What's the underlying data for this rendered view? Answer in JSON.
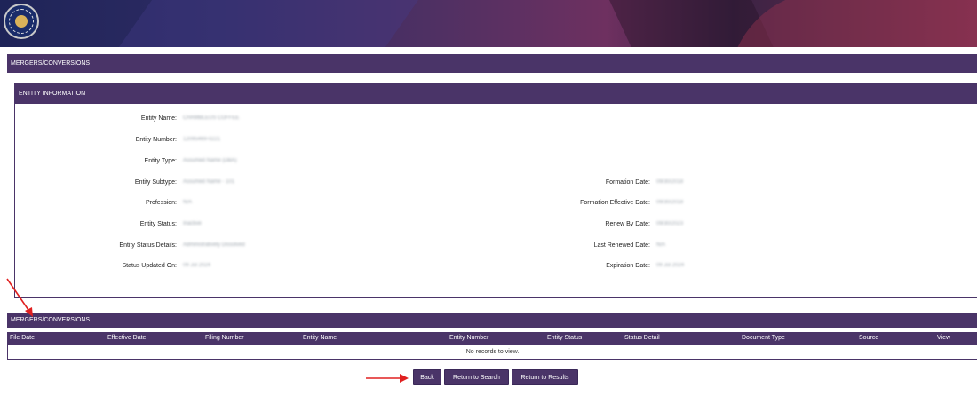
{
  "page": {
    "top_section_title": "MERGERS/CONVERSIONS",
    "entity_section_title": "ENTITY INFORMATION",
    "mergers_section_title": "MERGERS/CONVERSIONS"
  },
  "entity": {
    "left": [
      {
        "label": "Entity Name:",
        "value": "CHAMBLEUS COFFEE"
      },
      {
        "label": "Entity Number:",
        "value": "12095469-0221"
      },
      {
        "label": "Entity Type:",
        "value": "Assumed Name (DBA)"
      },
      {
        "label": "Entity Subtype:",
        "value": "Assumed Name - 101"
      },
      {
        "label": "Profession:",
        "value": "N/A"
      },
      {
        "label": "Entity Status:",
        "value": "Inactive"
      },
      {
        "label": "Entity Status Details:",
        "value": "Administratively Dissolved"
      },
      {
        "label": "Status Updated On:",
        "value": "09 Jul 2024"
      }
    ],
    "right": [
      {
        "label": "Formation Date:",
        "value": "09/30/2018"
      },
      {
        "label": "Formation Effective Date:",
        "value": "09/30/2018"
      },
      {
        "label": "Renew By Date:",
        "value": "09/30/2023"
      },
      {
        "label": "Last Renewed Date:",
        "value": "N/A"
      },
      {
        "label": "Expiration Date:",
        "value": "09 Jul 2024"
      }
    ]
  },
  "table": {
    "columns": [
      "File Date",
      "Effective Date",
      "Filing Number",
      "Entity Name",
      "Entity Number",
      "Entity Status",
      "Status Detail",
      "Document Type",
      "Source",
      "View"
    ],
    "empty_message": "No records to view."
  },
  "buttons": {
    "back": "Back",
    "return_search": "Return to Search",
    "return_results": "Return to Results"
  },
  "colors": {
    "header_bar": "#4a3468",
    "annotation_arrow": "#e02020"
  }
}
